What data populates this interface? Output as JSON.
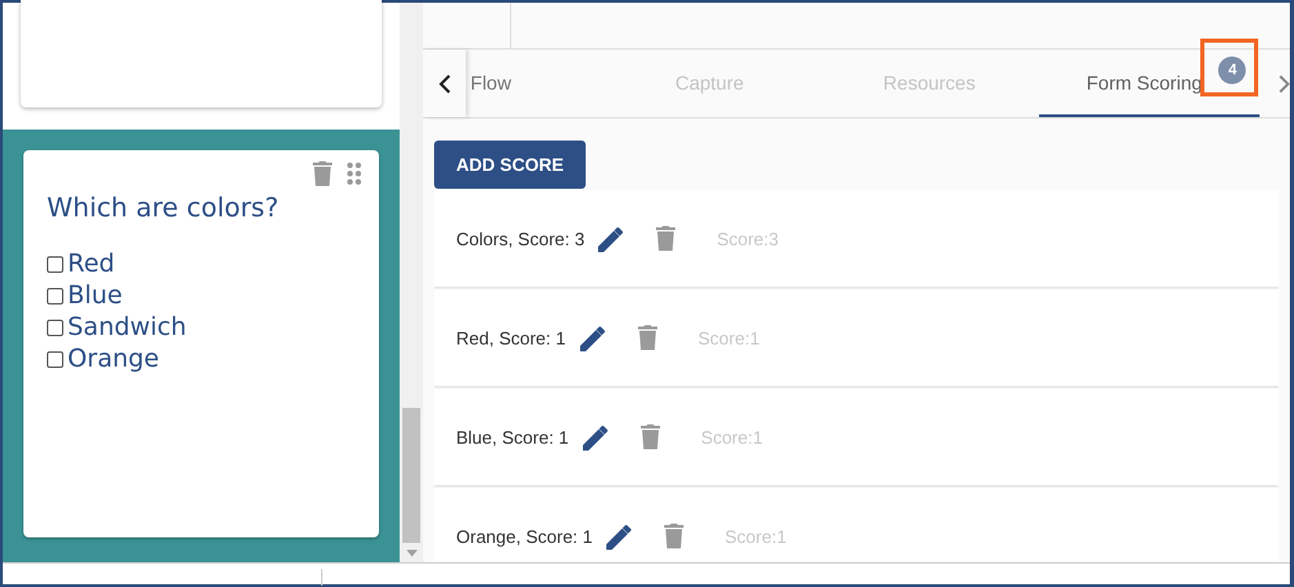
{
  "question_card": {
    "title": "Which are colors?",
    "options": [
      {
        "label": "Red",
        "checked": false
      },
      {
        "label": "Blue",
        "checked": false
      },
      {
        "label": "Sandwich",
        "checked": false
      },
      {
        "label": "Orange",
        "checked": false
      }
    ]
  },
  "tabs": [
    {
      "label": "Flow",
      "selected": false,
      "disabled": false
    },
    {
      "label": "Capture",
      "selected": false,
      "disabled": true
    },
    {
      "label": "Resources",
      "selected": false,
      "disabled": true
    },
    {
      "label": "Form Scoring",
      "selected": true,
      "disabled": false,
      "badge": "4",
      "highlighted": true
    }
  ],
  "add_button": "ADD SCORE",
  "scores": [
    {
      "label": "Colors, Score: 3",
      "score": "Score:3"
    },
    {
      "label": "Red, Score: 1",
      "score": "Score:1"
    },
    {
      "label": "Blue, Score: 1",
      "score": "Score:1"
    },
    {
      "label": "Orange, Score: 1",
      "score": "Score:1"
    }
  ]
}
